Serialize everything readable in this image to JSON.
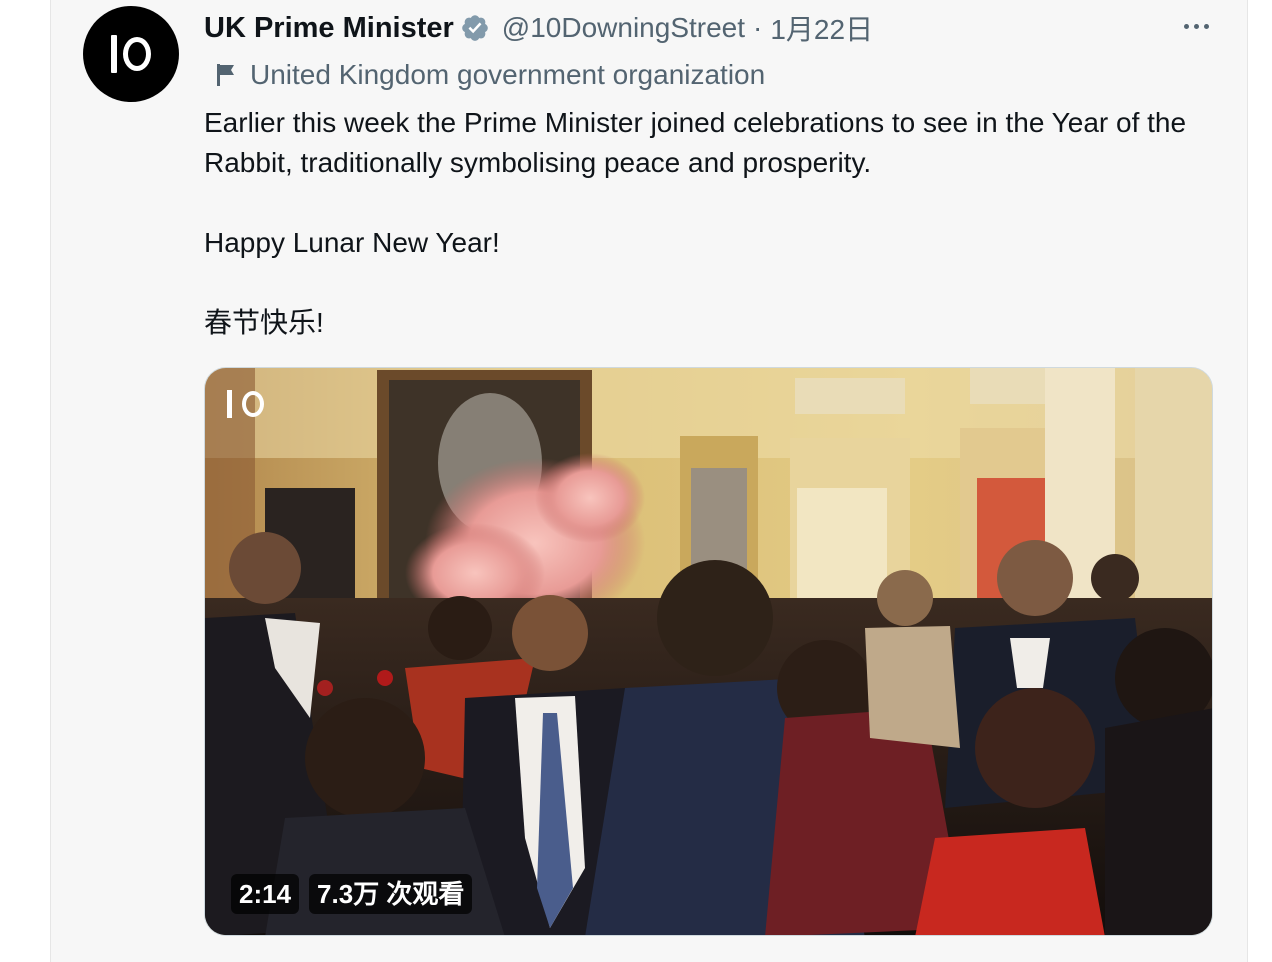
{
  "tweet": {
    "author_name": "UK Prime Minister",
    "handle": "@10DowningStreet",
    "separator": "·",
    "date": "1月22日",
    "affiliation": "United Kingdom government organization",
    "paragraphs": [
      "Earlier this week the Prime Minister joined celebrations to see in the Year of the Rabbit, traditionally symbolising peace and prosperity.",
      "Happy Lunar New Year!",
      "春节快乐!"
    ],
    "media": {
      "duration": "2:14",
      "views": "7.3万 次观看"
    }
  },
  "icons": {
    "verified": "verified-badge-icon",
    "affiliation": "flag-icon",
    "more": "more-options-icon",
    "avatar": "number-10-logo"
  },
  "colors": {
    "text_primary": "#0f1419",
    "text_secondary": "#536471",
    "verified": "#829aab",
    "card_background": "#f7f7f7"
  }
}
